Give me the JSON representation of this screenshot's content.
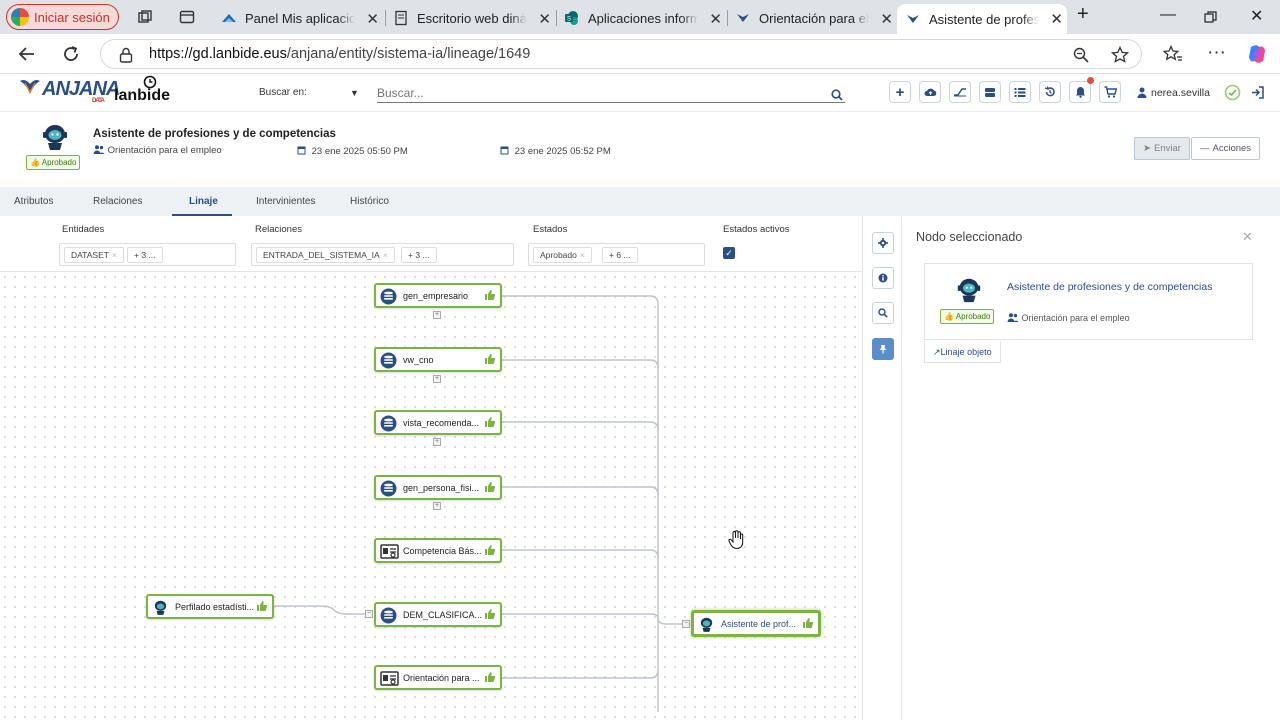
{
  "browser": {
    "profile_label": "Iniciar sesión",
    "tabs": [
      {
        "title": "Panel Mis aplicaciones"
      },
      {
        "title": "Escritorio web dinámico"
      },
      {
        "title": "Aplicaciones informáticas"
      },
      {
        "title": "Orientación para el empleo"
      },
      {
        "title": "Asistente de profesiones"
      }
    ],
    "url_host": "https://gd.lanbide.eus",
    "url_path": "/anjana/entity/sistema-ia/lineage/1649"
  },
  "app": {
    "logo_anjana": "ANJANA",
    "logo_anjana_sub": "DATA",
    "logo_lanbide": "lanbide",
    "search_scope_label": "Buscar en:",
    "search_placeholder": "Buscar...",
    "user": "nerea.sevilla"
  },
  "entity": {
    "title": "Asistente de profesiones y de competencias",
    "status": "Aprobado",
    "domain": "Orientación para el empleo",
    "created": "23 ene 2025 05:50 PM",
    "modified": "23 ene 2025 05:52 PM",
    "send_label": "Enviar",
    "actions_label": "Acciones"
  },
  "tabs": [
    {
      "label": "Atributos"
    },
    {
      "label": "Relaciones"
    },
    {
      "label": "Linaje"
    },
    {
      "label": "Intervinientes"
    },
    {
      "label": "Histórico"
    }
  ],
  "filters": {
    "entidades_label": "Entidades",
    "entidades_chip": "DATASET",
    "entidades_more": "+ 3 ...",
    "relaciones_label": "Relaciones",
    "relaciones_chip": "ENTRADA_DEL_SISTEMA_IA",
    "relaciones_more": "+ 3 ...",
    "estados_label": "Estados",
    "estados_chip": "Aprobado",
    "estados_more": "+ 6 ...",
    "estados_activos_label": "Estados activos"
  },
  "nodes": [
    {
      "label": "gen_empresario",
      "icon": "database-icon"
    },
    {
      "label": "vw_cno",
      "icon": "database-icon"
    },
    {
      "label": "vista_recomenda...",
      "icon": "database-icon"
    },
    {
      "label": "gen_persona_fisi...",
      "icon": "database-icon"
    },
    {
      "label": "Competencia Bás...",
      "icon": "document-icon"
    },
    {
      "label": "DEM_CLASIFICA...",
      "icon": "database-icon"
    },
    {
      "label": "Orientación para ...",
      "icon": "document-icon"
    },
    {
      "label": "Perfilado estadísti...",
      "icon": "robot-icon"
    },
    {
      "label": "Asistente de prof...",
      "icon": "robot-icon"
    }
  ],
  "panel": {
    "title": "Nodo seleccionado",
    "node_title": "Asistente de profesiones y de competencias",
    "node_status": "Aprobado",
    "node_domain": "Orientación para el empleo",
    "lineage_link": "Linaje objeto"
  },
  "colors": {
    "brand": "#2c4e86",
    "approved": "#7cb342",
    "tabbar": "#dfe3e8"
  }
}
